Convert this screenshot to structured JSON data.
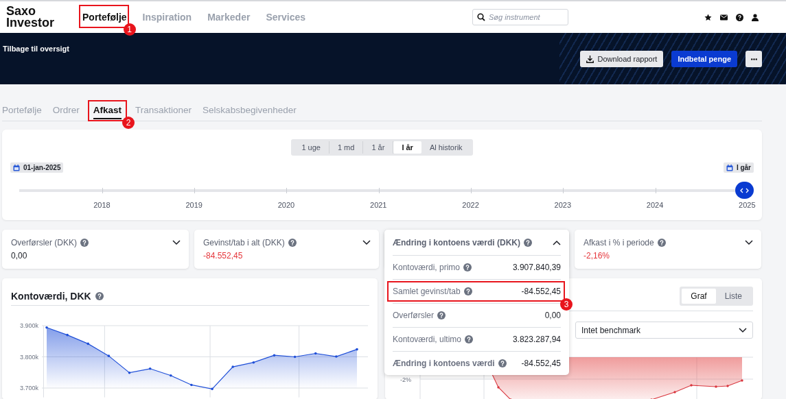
{
  "header": {
    "logo": [
      "Saxo",
      "Investor"
    ],
    "nav": [
      {
        "label": "Portefølje",
        "selected": true,
        "annotation": "1"
      },
      {
        "label": "Inspiration",
        "selected": false
      },
      {
        "label": "Markeder",
        "selected": false
      },
      {
        "label": "Services",
        "selected": false
      }
    ],
    "search": {
      "placeholder": "Søg instrument"
    }
  },
  "banner": {
    "back_link": "Tilbage til oversigt",
    "buttons": [
      {
        "kind": "secondary",
        "label": "Download rapport"
      },
      {
        "kind": "primary",
        "label": "Indbetal penge"
      },
      {
        "kind": "more"
      }
    ]
  },
  "tabs": [
    {
      "label": "Portefølje",
      "selected": false
    },
    {
      "label": "Ordrer",
      "selected": false
    },
    {
      "label": "Afkast",
      "selected": true,
      "annotation": "2"
    },
    {
      "label": "Transaktioner",
      "selected": false
    },
    {
      "label": "Selskabsbegivenheder",
      "selected": false
    }
  ],
  "period_options": [
    {
      "label": "1 uge",
      "selected": false
    },
    {
      "label": "1 md",
      "selected": false
    },
    {
      "label": "1 år",
      "selected": false
    },
    {
      "label": "I år",
      "selected": true
    },
    {
      "label": "Al historik",
      "selected": false
    }
  ],
  "timeline": {
    "start_date": "01-jan-2025",
    "end_date": "I går",
    "years": [
      "2018",
      "2019",
      "2020",
      "2021",
      "2022",
      "2023",
      "2024",
      "2025"
    ],
    "level": 1
  },
  "stats": [
    {
      "title": "Overførsler (DKK)",
      "value": "0,00",
      "negative": false,
      "expanded": false
    },
    {
      "title": "Gevinst/tab i alt (DKK)",
      "value": "-84.552,45",
      "negative": true,
      "expanded": false
    },
    {
      "title": "Ændring i kontoens værdi (DKK)",
      "expanded": true,
      "rows": [
        {
          "label": "Kontoværdi, primo",
          "value": "3.907.840,39",
          "bold": false
        },
        {
          "label": "Samlet gevinst/tab",
          "value": "-84.552,45",
          "bold": false,
          "annotation": "3"
        },
        {
          "label": "Overførsler",
          "value": "0,00",
          "bold": false
        },
        {
          "label": "Kontoværdi, ultimo",
          "value": "3.823.287,94",
          "bold": false
        },
        {
          "label": "Ændring i kontoens værdi",
          "value": "-84.552,45",
          "bold": true
        }
      ]
    },
    {
      "title": "Afkast i % i periode",
      "value": "-2,16%",
      "negative": true,
      "expanded": false
    }
  ],
  "value_chart": {
    "title": "Kontoværdi, DKK",
    "chart_data": {
      "type": "area",
      "grid": true,
      "ylim": [
        3670,
        3900
      ],
      "series": [
        {
          "color": "#1f4fd8",
          "values": [
            3894,
            3870,
            3842,
            3803,
            3749,
            3762,
            3740,
            3710,
            3697,
            3768,
            3782,
            3805,
            3800,
            3811,
            3801,
            3824
          ]
        }
      ],
      "yticks": [
        {
          "value": 3700,
          "label": "3.700k"
        },
        {
          "value": 3800,
          "label": "3.800k"
        },
        {
          "value": 3900,
          "label": "3.900k"
        }
      ]
    }
  },
  "return_card": {
    "view_toggle": [
      {
        "label": "Graf",
        "selected": true
      },
      {
        "label": "Liste",
        "selected": false
      }
    ],
    "benchmark": {
      "value": "Intet benchmark"
    },
    "tick_label": "-2%"
  }
}
